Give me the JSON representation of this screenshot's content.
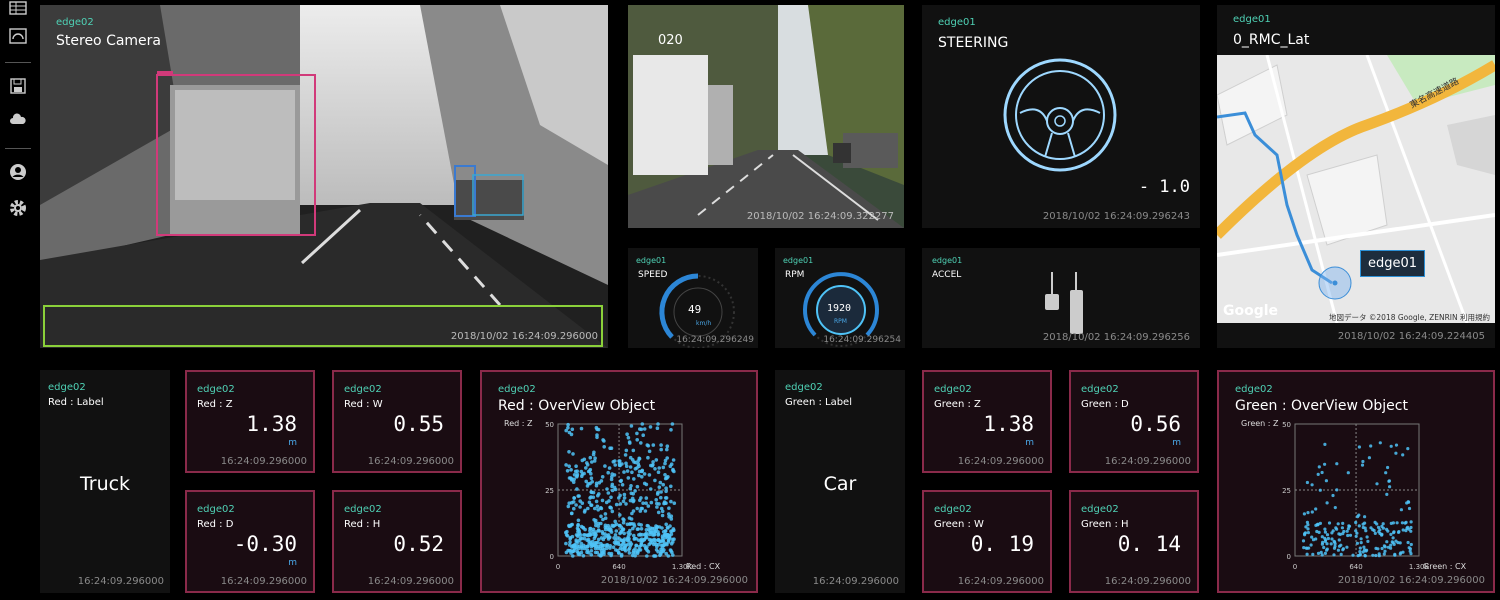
{
  "sidebar": {
    "icons": [
      "grid-icon",
      "gauge-icon",
      "save-icon",
      "cloud-icon",
      "user-icon",
      "gear-icon"
    ]
  },
  "stereo": {
    "tag": "edge02",
    "title": "Stereo Camera",
    "ts": "2018/10/02 16:24:09.296000"
  },
  "front": {
    "overlay": "020",
    "ts": "2018/10/02 16:24:09.322277"
  },
  "steering": {
    "tag": "edge01",
    "title": "STEERING",
    "value": "- 1.0",
    "ts": "2018/10/02 16:24:09.296243"
  },
  "map": {
    "tag": "edge01",
    "title": "0_RMC_Lat",
    "marker": "edge01",
    "road_label": "東名高速道路",
    "google": "Google",
    "attribution": "地図データ ©2018 Google, ZENRIN   利用規約",
    "ts": "2018/10/02 16:24:09.224405"
  },
  "speed": {
    "tag": "edge01",
    "title": "SPEED",
    "value": "49",
    "unit": "km/h",
    "ts": "16:24:09.296249"
  },
  "rpm": {
    "tag": "edge01",
    "title": "RPM",
    "value": "1920",
    "unit": "RPM",
    "ts": "16:24:09.296254"
  },
  "accel": {
    "tag": "edge01",
    "title": "ACCEL",
    "ts": "2018/10/02 16:24:09.296256"
  },
  "red_label": {
    "tag": "edge02",
    "title": "Red : Label",
    "value": "Truck",
    "ts": "16:24:09.296000"
  },
  "red_z": {
    "tag": "edge02",
    "title": "Red : Z",
    "value": "1.38",
    "unit": "m",
    "ts": "16:24:09.296000"
  },
  "red_w": {
    "tag": "edge02",
    "title": "Red : W",
    "value": "0.55",
    "ts": "16:24:09.296000"
  },
  "red_d": {
    "tag": "edge02",
    "title": "Red : D",
    "value": "-0.30",
    "unit": "m",
    "ts": "16:24:09.296000"
  },
  "red_h": {
    "tag": "edge02",
    "title": "Red : H",
    "value": "0.52",
    "ts": "16:24:09.296000"
  },
  "red_ov": {
    "tag": "edge02",
    "title": "Red : OverView Object",
    "ts": "2018/10/02 16:24:09.296000"
  },
  "green_label": {
    "tag": "edge02",
    "title": "Green : Label",
    "value": "Car",
    "ts": "16:24:09.296000"
  },
  "green_z": {
    "tag": "edge02",
    "title": "Green : Z",
    "value": "1.38",
    "unit": "m",
    "ts": "16:24:09.296000"
  },
  "green_d": {
    "tag": "edge02",
    "title": "Green : D",
    "value": "0.56",
    "unit": "m",
    "ts": "16:24:09.296000"
  },
  "green_w": {
    "tag": "edge02",
    "title": "Green : W",
    "value": "0. 19",
    "ts": "16:24:09.296000"
  },
  "green_h": {
    "tag": "edge02",
    "title": "Green : H",
    "value": "0. 14",
    "ts": "16:24:09.296000"
  },
  "green_ov": {
    "tag": "edge02",
    "title": "Green : OverView Object",
    "ts": "2018/10/02 16:24:09.296000"
  },
  "chart_data": [
    {
      "type": "scatter",
      "title": "Red : OverView Object",
      "ylabel": "Red : Z",
      "xlabel": "Red : CX",
      "xlim": [
        0,
        1300
      ],
      "ylim": [
        0,
        50
      ],
      "x_ticks": [
        "0",
        "640",
        "1.30K"
      ],
      "y_ticks": [
        "0",
        "25",
        "50"
      ],
      "color": "#4fc3f7",
      "density": "dense"
    },
    {
      "type": "scatter",
      "title": "Green : OverView Object",
      "ylabel": "Green : Z",
      "xlabel": "Green : CX",
      "xlim": [
        0,
        1300
      ],
      "ylim": [
        0,
        50
      ],
      "x_ticks": [
        "0",
        "640",
        "1.30K"
      ],
      "y_ticks": [
        "0",
        "25",
        "50"
      ],
      "color": "#4fc3f7",
      "density": "sparse"
    }
  ]
}
